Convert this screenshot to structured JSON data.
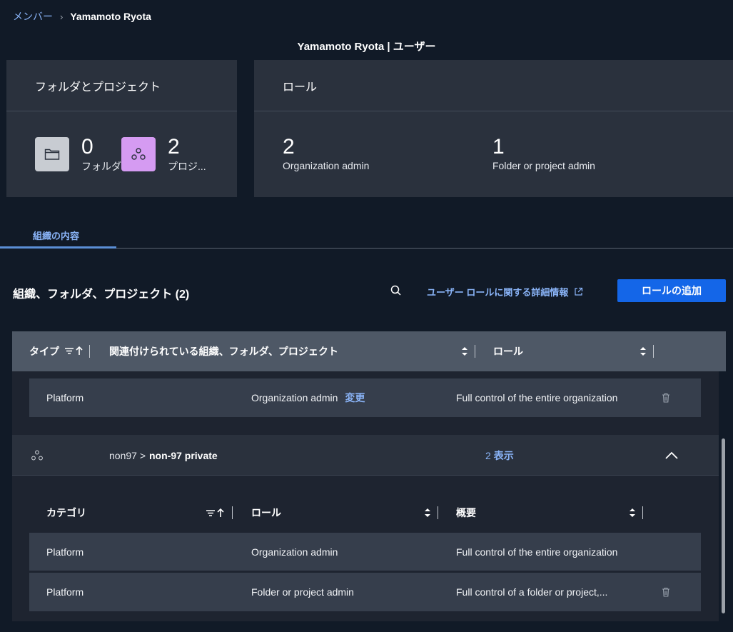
{
  "breadcrumb": {
    "parent": "メンバー",
    "separator": "›",
    "current": "Yamamoto Ryota"
  },
  "page_title": "Yamamoto Ryota | ユーザー",
  "folders_card": {
    "title": "フォルダとプロジェクト",
    "folders": {
      "count": "0",
      "label": "フォルダ"
    },
    "projects": {
      "count": "2",
      "label": "プロジ..."
    }
  },
  "roles_card": {
    "title": "ロール",
    "items": [
      {
        "count": "2",
        "label": "Organization admin"
      },
      {
        "count": "1",
        "label": "Folder or project admin"
      }
    ]
  },
  "tabs": [
    {
      "label": "組織の内容",
      "active": true
    }
  ],
  "section": {
    "title": "組織、フォルダ、プロジェクト (2)",
    "more_info_link": "ユーザー ロールに関する詳細情報",
    "add_role_button": "ロールの追加"
  },
  "table": {
    "headers": {
      "type": "タイプ",
      "associated": "関連付けられている組織、フォルダ、プロジェクト",
      "role": "ロール"
    },
    "org_row": {
      "category": "Platform",
      "role": "Organization admin",
      "change": "変更",
      "summary": "Full control of the entire organization"
    },
    "group": {
      "path_prefix": "non97 >",
      "path_name": "non-97 private",
      "count": "2",
      "show_label": "表示",
      "sub_headers": {
        "category": "カテゴリ",
        "role": "ロール",
        "summary": "概要"
      },
      "rows": [
        {
          "category": "Platform",
          "role": "Organization admin",
          "summary": "Full control of the entire organization"
        },
        {
          "category": "Platform",
          "role": "Folder or project admin",
          "summary": "Full control of a folder or project,..."
        }
      ]
    }
  },
  "colors": {
    "background": "#111a27",
    "card": "#2a313d",
    "accent": "#1466e8",
    "link": "#8ab4f8",
    "project_tile": "#d59bf2"
  }
}
